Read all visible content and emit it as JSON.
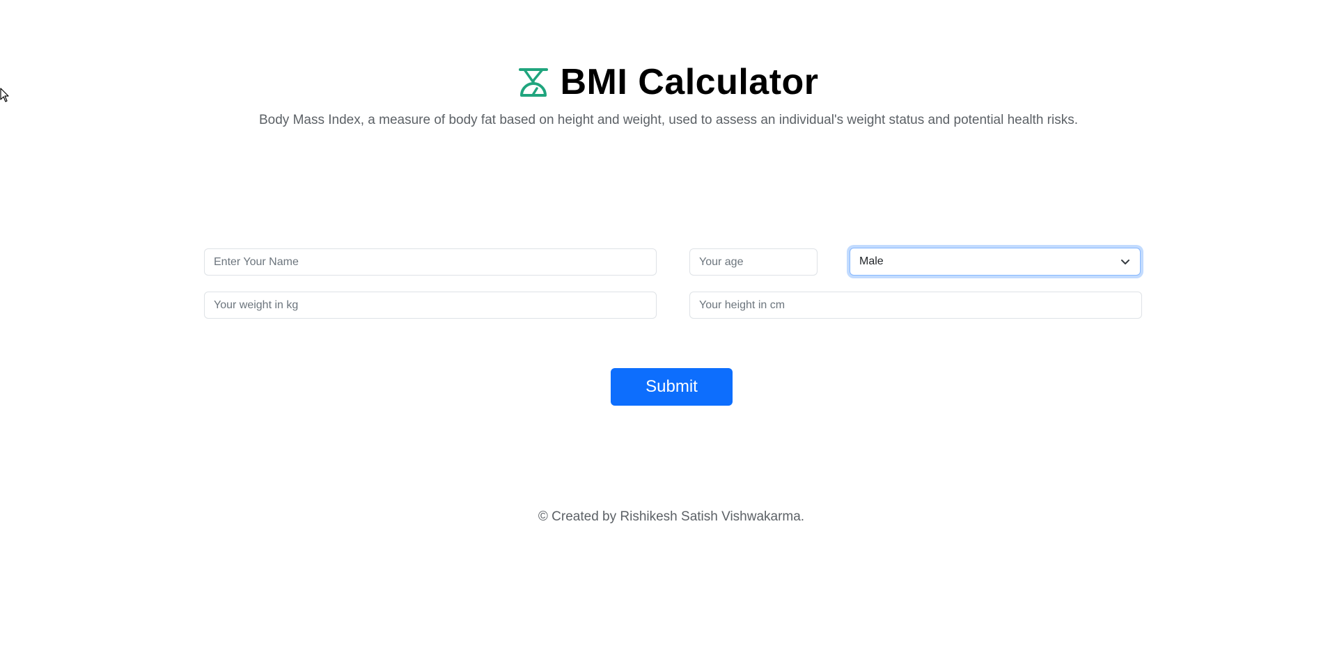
{
  "header": {
    "title": "BMI Calculator",
    "icon": "scale-icon",
    "icon_color": "#20a57e",
    "subtitle": "Body Mass Index, a measure of body fat based on height and weight, used to assess an individual's weight status and potential health risks."
  },
  "form": {
    "name_placeholder": "Enter Your Name",
    "age_placeholder": "Your age",
    "gender_selected": "Male",
    "weight_placeholder": "Your weight in kg",
    "height_placeholder": "Your height in cm",
    "submit_label": "Submit",
    "submit_color": "#0d6efd"
  },
  "footer": {
    "text": "© Created by Rishikesh Satish Vishwakarma."
  }
}
